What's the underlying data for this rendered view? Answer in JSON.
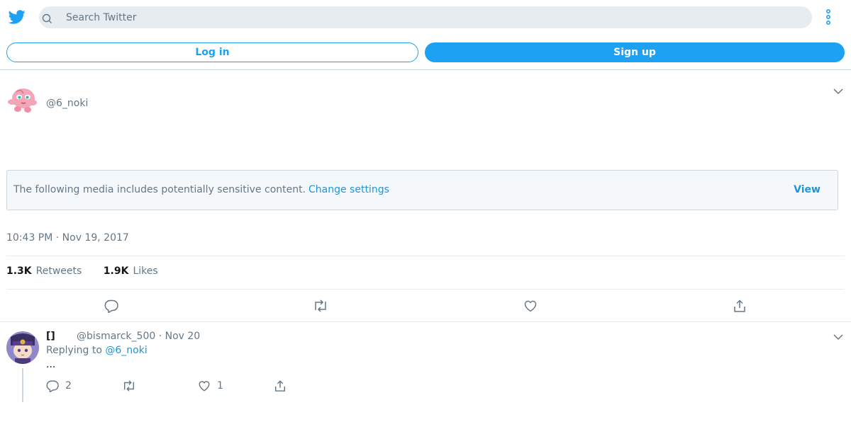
{
  "header": {
    "search_placeholder": "Search Twitter",
    "login_label": "Log in",
    "signup_label": "Sign up"
  },
  "tweet": {
    "handle": "@6_noki",
    "sensitive_notice": "The following media includes potentially sensitive content.",
    "sensitive_link": "Change settings",
    "view_label": "View",
    "timestamp": "10:43 PM · Nov 19, 2017",
    "retweets_count": "1.3K",
    "retweets_label": "Retweets",
    "likes_count": "1.9K",
    "likes_label": "Likes"
  },
  "reply": {
    "name": "[]",
    "handle_date": "@bismarck_500 · Nov 20",
    "replying_to_prefix": "Replying to",
    "replying_to_handle": "@6_noki",
    "text": "...",
    "reply_count": "2",
    "retweet_count": "",
    "like_count": "1"
  },
  "colors": {
    "brand": "#1da1f2",
    "link": "#1b95e0",
    "muted": "#657786",
    "border": "#ccd6dd"
  },
  "icons": [
    "twitter-bird-icon",
    "search-icon",
    "more-vertical-icon",
    "chevron-down-icon",
    "reply-icon",
    "retweet-icon",
    "like-icon",
    "share-icon"
  ]
}
